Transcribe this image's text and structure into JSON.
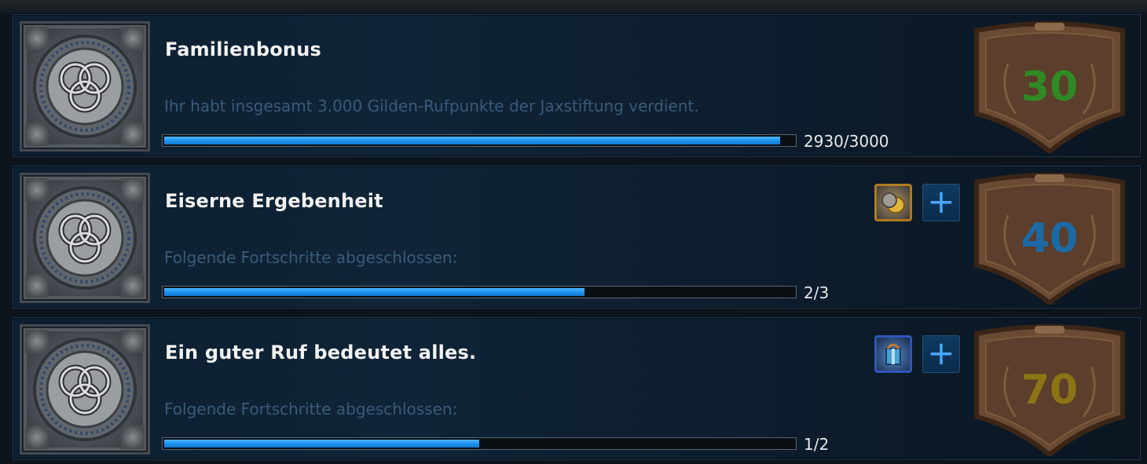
{
  "achievements": [
    {
      "title": "Familienbonus",
      "description": "Ihr habt insgesamt 3.000 Gilden-Rufpunkte der Jaxstiftung verdient.",
      "progress_text": "2930/3000",
      "progress": 0.977,
      "points": "30",
      "points_color": "#2f8a23",
      "reward_icon": null
    },
    {
      "title": "Eiserne Ergebenheit",
      "description": "Folgende Fortschritte abgeschlossen:",
      "progress_text": "2/3",
      "progress": 0.667,
      "points": "40",
      "points_color": "#1a6aa8",
      "reward_icon": "gold-coin-reward-icon"
    },
    {
      "title": "Ein guter Ruf bedeutet alles.",
      "description": "Folgende Fortschritte abgeschlossen:",
      "progress_text": "1/2",
      "progress": 0.5,
      "points": "70",
      "points_color": "#8a7414",
      "reward_icon": "gift-box-reward-icon"
    }
  ],
  "plus_label": "+"
}
